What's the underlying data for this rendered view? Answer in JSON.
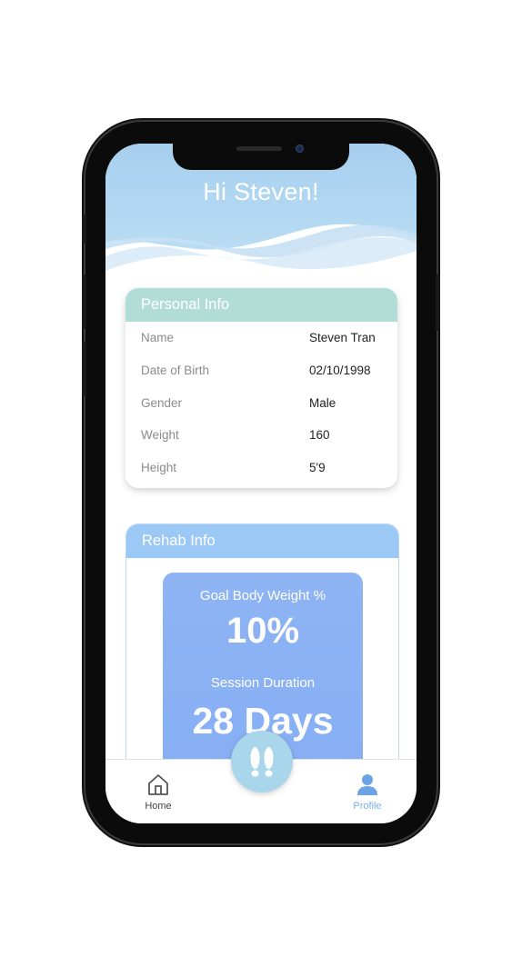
{
  "header": {
    "greeting": "Hi Steven!"
  },
  "personal_info": {
    "title": "Personal Info",
    "rows": [
      {
        "label": "Name",
        "value": "Steven Tran"
      },
      {
        "label": "Date of Birth",
        "value": "02/10/1998"
      },
      {
        "label": "Gender",
        "value": "Male"
      },
      {
        "label": "Weight",
        "value": "160"
      },
      {
        "label": "Height",
        "value": "5'9"
      }
    ]
  },
  "rehab_info": {
    "title": "Rehab Info",
    "goal_label": "Goal Body Weight %",
    "goal_value": "10%",
    "duration_label": "Session Duration",
    "duration_value": "28 Days"
  },
  "nav": {
    "home_label": "Home",
    "profile_label": "Profile",
    "center_icon": "footprints-icon"
  },
  "colors": {
    "header_gradient_top": "#a9d2ef",
    "personal_header": "#b2ddd7",
    "rehab_header": "#9bc8f5",
    "goal_box": "#8eb4f4",
    "profile_active": "#7ab0ec",
    "center_button": "#a9d6ea"
  }
}
